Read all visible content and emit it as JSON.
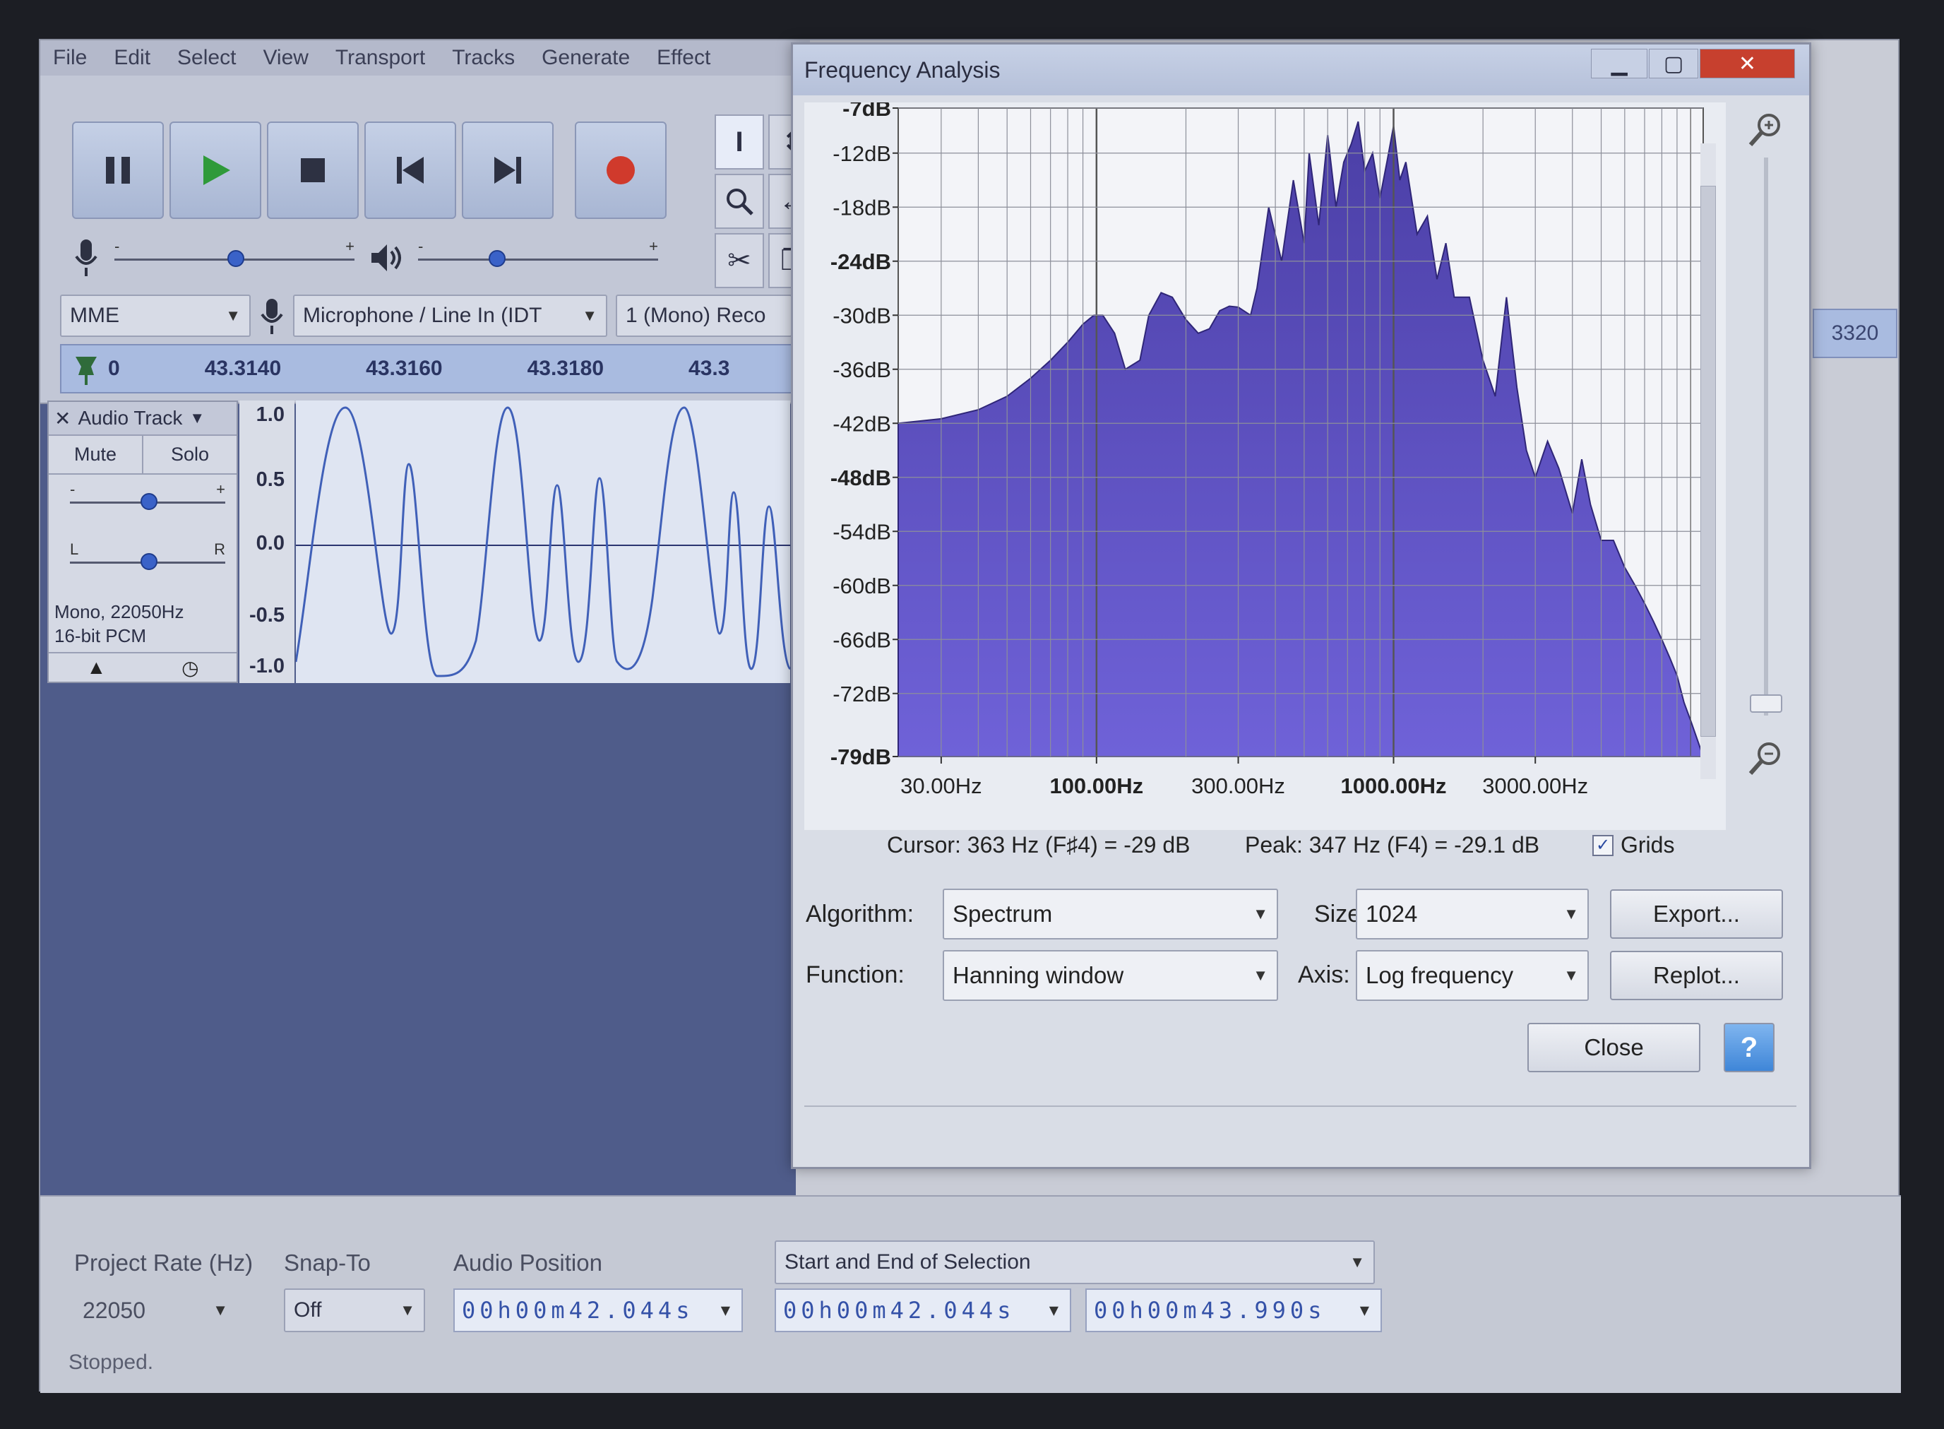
{
  "menu": [
    "File",
    "Edit",
    "Select",
    "View",
    "Transport",
    "Tracks",
    "Generate",
    "Effect"
  ],
  "device": {
    "host": "MME",
    "input": "Microphone / Line In (IDT",
    "channels": "1 (Mono) Reco"
  },
  "timeline": {
    "start": "0",
    "ticks": [
      "43.3140",
      "43.3160",
      "43.3180",
      "43.3"
    ],
    "right_tick": "3320"
  },
  "track": {
    "name": "Audio Track",
    "mute": "Mute",
    "solo": "Solo",
    "gain_minus": "-",
    "gain_plus": "+",
    "pan_left": "L",
    "pan_right": "R",
    "info_line1": "Mono, 22050Hz",
    "info_line2": "16-bit PCM",
    "scale": [
      "1.0",
      "0.5",
      "0.0",
      "-0.5",
      "-1.0"
    ]
  },
  "dialog": {
    "title": "Frequency Analysis",
    "cursor_label": "Cursor:",
    "cursor_value": "363 Hz (F♯4) = -29 dB",
    "peak_label": "Peak:",
    "peak_value": "347 Hz (F4) = -29.1 dB",
    "grids_label": "Grids",
    "grids_checked": true,
    "algorithm_label": "Algorithm:",
    "algorithm_value": "Spectrum",
    "size_label": "Size:",
    "size_value": "1024",
    "function_label": "Function:",
    "function_value": "Hanning window",
    "axis_label": "Axis:",
    "axis_value": "Log frequency",
    "export_button": "Export...",
    "replot_button": "Replot...",
    "close_button": "Close",
    "help_button": "?"
  },
  "bottom": {
    "project_rate_label": "Project Rate (Hz)",
    "project_rate_value": "22050",
    "snap_label": "Snap-To",
    "snap_value": "Off",
    "audio_position_label": "Audio Position",
    "audio_position_value": "00h00m42.044s",
    "selection_mode": "Start and End of Selection",
    "selection_start": "00h00m42.044s",
    "selection_end": "00h00m43.990s",
    "status": "Stopped."
  },
  "chart_data": {
    "type": "area",
    "title": "",
    "xlabel": "",
    "ylabel": "",
    "x_scale": "log",
    "x_tick_labels": [
      "30.00Hz",
      "100.00Hz",
      "300.00Hz",
      "1000.00Hz",
      "3000.00Hz"
    ],
    "y_tick_labels": [
      "-7dB",
      "-12dB",
      "-18dB",
      "-24dB",
      "-30dB",
      "-36dB",
      "-42dB",
      "-48dB",
      "-54dB",
      "-60dB",
      "-66dB",
      "-72dB",
      "-79dB"
    ],
    "xlim": [
      21.5,
      11025
    ],
    "ylim": [
      -79,
      -7
    ],
    "grid": true,
    "fill_color": "#4b3fa6",
    "x": [
      21.5,
      30,
      40,
      50,
      60,
      70,
      80,
      90,
      98,
      105,
      115,
      125,
      140,
      150,
      165,
      180,
      200,
      220,
      240,
      260,
      280,
      300,
      330,
      347,
      380,
      420,
      460,
      500,
      520,
      560,
      600,
      640,
      680,
      720,
      760,
      800,
      850,
      900,
      950,
      1000,
      1050,
      1100,
      1200,
      1300,
      1400,
      1500,
      1600,
      1800,
      2000,
      2200,
      2400,
      2600,
      2800,
      3000,
      3300,
      3600,
      4000,
      4300,
      4600,
      5000,
      5500,
      6000,
      6500,
      7000,
      7500,
      8000,
      8500,
      9000,
      9500,
      10000,
      10500,
      11025
    ],
    "y": [
      -42,
      -41.5,
      -40.5,
      -39,
      -37,
      -35,
      -33,
      -31,
      -30,
      -30,
      -32,
      -36,
      -35,
      -30,
      -27.5,
      -28,
      -30.5,
      -32,
      -31.5,
      -29.5,
      -29,
      -29.1,
      -30,
      -27,
      -18,
      -24,
      -15,
      -22,
      -12,
      -20,
      -10,
      -18,
      -13,
      -11,
      -8.5,
      -14,
      -12,
      -17,
      -13,
      -9,
      -15,
      -13,
      -21,
      -19,
      -26,
      -22,
      -28,
      -28,
      -35,
      -39,
      -28,
      -38,
      -45,
      -48,
      -44,
      -47,
      -52,
      -46,
      -51,
      -55,
      -55,
      -58,
      -60,
      -62,
      -64,
      -66,
      -68,
      -70,
      -73,
      -75,
      -77,
      -79
    ]
  }
}
